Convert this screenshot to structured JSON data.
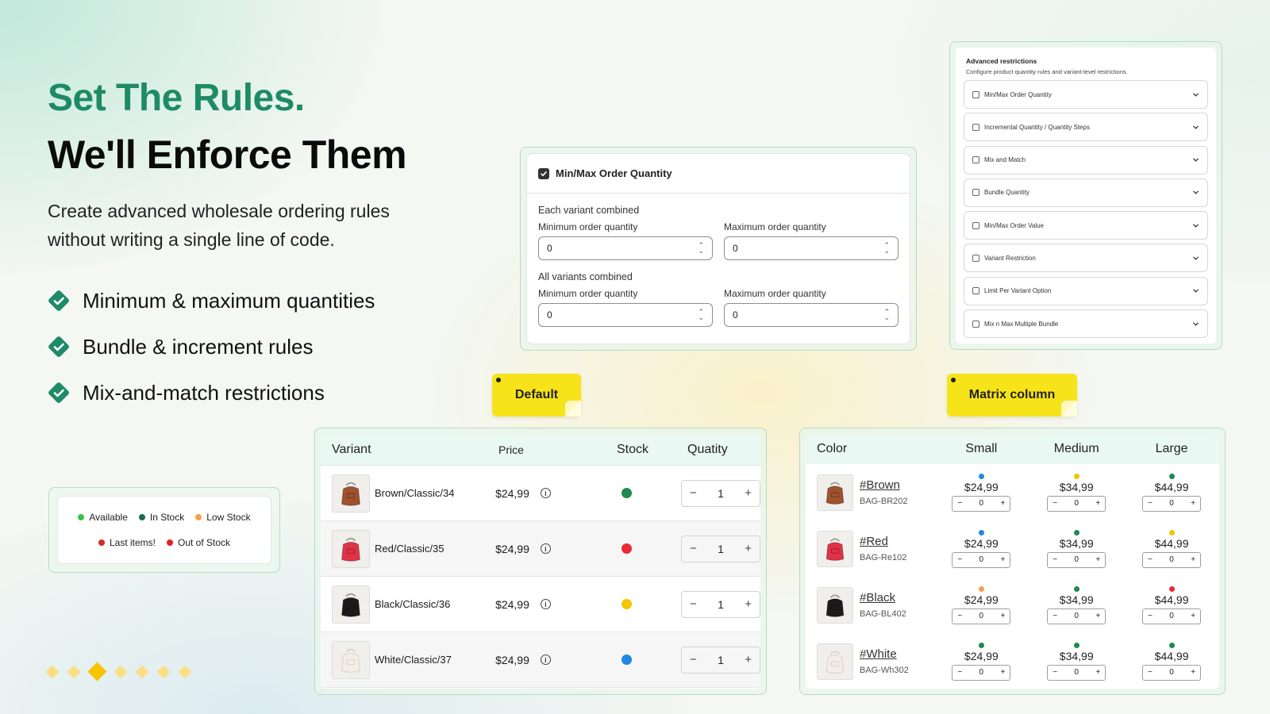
{
  "hero": {
    "title": "Set The Rules.",
    "subtitle": "We'll Enforce Them",
    "description": "Create advanced wholesale ordering rules without writing a single line of code.",
    "features": [
      "Minimum & maximum quantities",
      "Bundle & increment rules",
      "Mix-and-match restrictions"
    ]
  },
  "legend": {
    "row1": [
      {
        "label": "Available",
        "color": "#3cc14a"
      },
      {
        "label": "In Stock",
        "color": "#1e6b4a"
      },
      {
        "label": "Low Stock",
        "color": "#f5a04b"
      }
    ],
    "row2": [
      {
        "label": "Last items!",
        "color": "#d62b2b"
      },
      {
        "label": "Out of Stock",
        "color": "#e5202a"
      }
    ]
  },
  "pager": {
    "count": 7,
    "active": 2
  },
  "minmax": {
    "header": "Min/Max Order Quantity",
    "sections": [
      {
        "title": "Each variant combined",
        "min_label": "Minimum order quantity",
        "min_value": "0",
        "max_label": "Maximum order quantity",
        "max_value": "0"
      },
      {
        "title": "All variants combined",
        "min_label": "Minimum order quantity",
        "min_value": "0",
        "max_label": "Maximum order quantity",
        "max_value": "0"
      }
    ]
  },
  "advanced": {
    "title": "Advanced restrictions",
    "description": "Configure product quantity rules and variant-level restrictions.",
    "items": [
      "Min/Max Order Quantity",
      "Incremental Quantity / Quantity Steps",
      "Mix and Match",
      "Bundle Quantity",
      "Min/Max Order Value",
      "Variant Restriction",
      "Limit Per Variant Option",
      "Mix n Max Multiple Bundle"
    ]
  },
  "notes": {
    "default": "Default",
    "matrix": "Matrix column"
  },
  "default_table": {
    "headers": {
      "variant": "Variant",
      "price": "Price",
      "stock": "Stock",
      "quantity": "Quatity"
    },
    "rows": [
      {
        "variant": "Brown/Classic/34",
        "price": "$24,99",
        "stock_color": "#1e8a4e",
        "qty": "1",
        "bag_color": "#a0522d"
      },
      {
        "variant": "Red/Classic/35",
        "price": "$24,99",
        "stock_color": "#ea2a35",
        "qty": "1",
        "bag_color": "#e0334a"
      },
      {
        "variant": "Black/Classic/36",
        "price": "$24,99",
        "stock_color": "#f5c400",
        "qty": "1",
        "bag_color": "#1b1b1b"
      },
      {
        "variant": "White/Classic/37",
        "price": "$24,99",
        "stock_color": "#1e88e5",
        "qty": "1",
        "bag_color": "#f3ece7"
      }
    ]
  },
  "matrix": {
    "headers": {
      "color": "Color",
      "small": "Small",
      "medium": "Medium",
      "large": "Large"
    },
    "rows": [
      {
        "name": "#Brown",
        "sku": "BAG-BR202",
        "bag_color": "#a0522d",
        "cells": [
          {
            "price": "$24,99",
            "qty": "0",
            "dot": "#1e88e5"
          },
          {
            "price": "$34,99",
            "qty": "0",
            "dot": "#f5c400"
          },
          {
            "price": "$44,99",
            "qty": "0",
            "dot": "#1e8a4e"
          }
        ]
      },
      {
        "name": "#Red",
        "sku": "BAG-Re102",
        "bag_color": "#e0334a",
        "cells": [
          {
            "price": "$24,99",
            "qty": "0",
            "dot": "#1e88e5"
          },
          {
            "price": "$34,99",
            "qty": "0",
            "dot": "#1e8a4e"
          },
          {
            "price": "$44,99",
            "qty": "0",
            "dot": "#f5c400"
          }
        ]
      },
      {
        "name": "#Black",
        "sku": "BAG-BL402",
        "bag_color": "#1b1b1b",
        "cells": [
          {
            "price": "$24,99",
            "qty": "0",
            "dot": "#f5a04b"
          },
          {
            "price": "$34,99",
            "qty": "0",
            "dot": "#1e8a4e"
          },
          {
            "price": "$44,99",
            "qty": "0",
            "dot": "#ea2a35"
          }
        ]
      },
      {
        "name": "#White",
        "sku": "BAG-Wh302",
        "bag_color": "#f3ece7",
        "cells": [
          {
            "price": "$24,99",
            "qty": "0",
            "dot": "#1e8a4e"
          },
          {
            "price": "$34,99",
            "qty": "0",
            "dot": "#1e8a4e"
          },
          {
            "price": "$44,99",
            "qty": "0",
            "dot": "#1e8a4e"
          }
        ]
      }
    ]
  }
}
